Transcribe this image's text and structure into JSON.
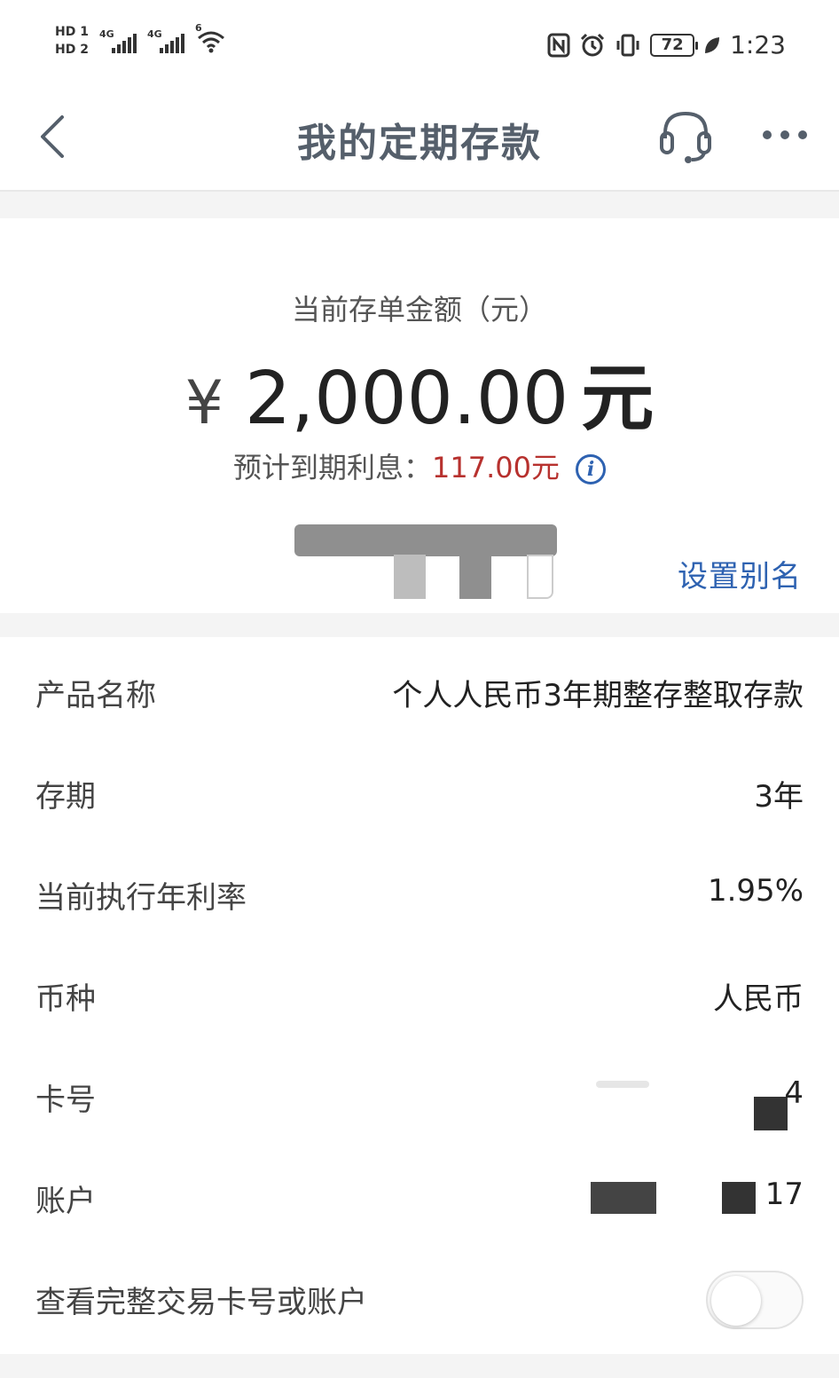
{
  "status_bar": {
    "sim1": "HD 1",
    "sim2": "HD 2",
    "net1": "4G",
    "net2": "4G",
    "wifi_gen": "6",
    "battery": "72",
    "time": "1:23"
  },
  "nav": {
    "title": "我的定期存款"
  },
  "summary": {
    "label": "当前存单金额（元）",
    "currency_symbol": "¥",
    "amount": "2,000.00",
    "amount_unit": "元",
    "interest_label": "预计到期利息：",
    "interest_value": "117.00元",
    "set_alias": "设置别名"
  },
  "details": {
    "rows": [
      {
        "label": "产品名称",
        "value": "个人人民币3年期整存整取存款"
      },
      {
        "label": "存期",
        "value": "3年"
      },
      {
        "label": "当前执行年利率",
        "value": "1.95%"
      },
      {
        "label": "币种",
        "value": "人民币"
      },
      {
        "label": "卡号",
        "value": "4"
      },
      {
        "label": "账户",
        "value": "17"
      }
    ],
    "toggle_label": "查看完整交易卡号或账户",
    "toggle_on": false
  },
  "colors": {
    "accent_blue": "#2e62b1",
    "interest_red": "#b7312e",
    "title_gray": "#555f6b"
  }
}
